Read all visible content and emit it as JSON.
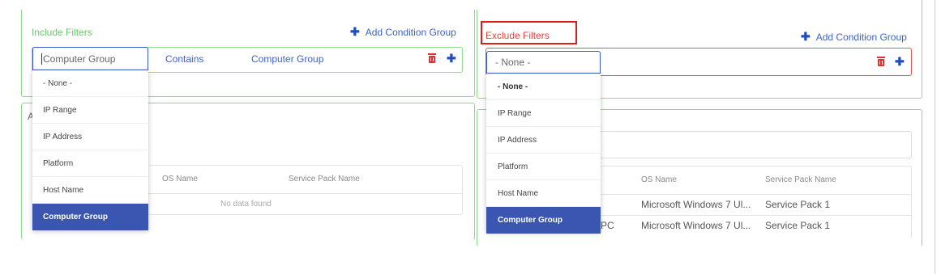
{
  "include": {
    "title": "Include Filters",
    "add_group_label": "Add Condition Group",
    "condition": {
      "field_value": "Computer Group",
      "operator": "Contains",
      "value": "Computer Group"
    },
    "dropdown_options": [
      "- None -",
      "IP Range",
      "IP Address",
      "Platform",
      "Host Name",
      "Computer Group"
    ],
    "selected_option": "Computer Group"
  },
  "exclude": {
    "title": "Exclude Filters",
    "add_group_label": "Add Condition Group",
    "condition": {
      "field_value": "- None -"
    },
    "dropdown_options": [
      "- None -",
      "IP Range",
      "IP Address",
      "Platform",
      "Host Name",
      "Computer Group"
    ],
    "selected_option": "Computer Group"
  },
  "left_table": {
    "stub_label": "A",
    "columns": [
      "OS Name",
      "Service Pack Name"
    ],
    "empty_text": "No data found"
  },
  "right_table": {
    "columns": [
      "OS Name",
      "Service Pack Name"
    ],
    "rows": [
      {
        "host_suffix": "",
        "os_name": "Microsoft Windows 7 Ul...",
        "service_pack": "Service Pack 1"
      },
      {
        "host_suffix": "PC",
        "os_name": "Microsoft Windows 7 Ul...",
        "service_pack": "Service Pack 1"
      }
    ]
  },
  "icons": {
    "add": "plus-icon",
    "delete": "trash-icon"
  },
  "colors": {
    "include_accent": "#6cc46c",
    "exclude_accent": "#e0463f",
    "link_blue": "#3d63c5",
    "selected_bg": "#3a56b0"
  }
}
